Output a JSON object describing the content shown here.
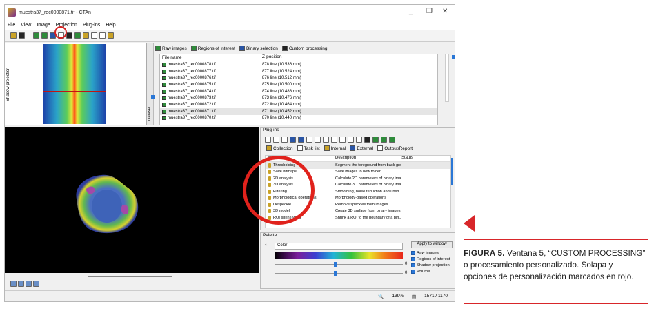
{
  "window": {
    "title": "muestra37_rec0000871.tif - CTAn",
    "controls": [
      "_",
      "❐",
      "✕"
    ]
  },
  "menu": [
    "File",
    "View",
    "Image",
    "Projection",
    "Plug-ins",
    "Help"
  ],
  "shadow_panel": {
    "label": "Shadow projection"
  },
  "dataset_panel": {
    "side_label": "Dataset",
    "tabs": [
      "Raw images",
      "Regions of interest",
      "Binary selection",
      "Custom processing"
    ],
    "columns": [
      "File name",
      "Z-position"
    ],
    "rows": [
      {
        "file": "muestra37_rec0000878.tif",
        "z": "878 line (10.536 mm)"
      },
      {
        "file": "muestra37_rec0000877.tif",
        "z": "877 line (10.524 mm)"
      },
      {
        "file": "muestra37_rec0000876.tif",
        "z": "876 line (10.512 mm)"
      },
      {
        "file": "muestra37_rec0000875.tif",
        "z": "875 line (10.500 mm)"
      },
      {
        "file": "muestra37_rec0000874.tif",
        "z": "874 line (10.488 mm)"
      },
      {
        "file": "muestra37_rec0000873.tif",
        "z": "873 line (10.476 mm)"
      },
      {
        "file": "muestra37_rec0000872.tif",
        "z": "872 line (10.464 mm)"
      },
      {
        "file": "muestra37_rec0000871.tif",
        "z": "871 line (10.452 mm)"
      },
      {
        "file": "muestra37_rec0000870.tif",
        "z": "870 line (10.440 mm)"
      }
    ]
  },
  "plugins": {
    "title": "Plug-ins",
    "tabs": [
      "Collection",
      "Task list",
      "Internal",
      "External",
      "Output/Report"
    ],
    "columns": [
      "Name",
      "Description",
      "Status"
    ],
    "rows": [
      {
        "name": "Thresholding",
        "desc": "Segment the foreground from back gro..."
      },
      {
        "name": "Save bitmaps",
        "desc": "Save images to new folder"
      },
      {
        "name": "2D analysis",
        "desc": "Calculate 2D parameters of binary ima..."
      },
      {
        "name": "3D analysis",
        "desc": "Calculate 3D parameters of binary ima..."
      },
      {
        "name": "Filtering",
        "desc": "Smoothing, noise reduction and unsh..."
      },
      {
        "name": "Morphological operations",
        "desc": "Morphology-based operations"
      },
      {
        "name": "Despeckle",
        "desc": "Remove speckles from images"
      },
      {
        "name": "3D model",
        "desc": "Create 3D surface from binary images"
      },
      {
        "name": "ROI shrink-wrap",
        "desc": "Shrink a ROI to the boundary of a bin..."
      }
    ]
  },
  "palette": {
    "title": "Palette",
    "selected": "Color",
    "zero_a": "0",
    "zero_b": "0",
    "apply_label": "Apply to window",
    "checks": [
      "Raw images",
      "Regions of interest",
      "Shadow projection",
      "Volume"
    ]
  },
  "status": {
    "zoom": "139%",
    "slice": "1571 / 1170"
  },
  "caption": {
    "label": "FIGURA 5.",
    "text": " Ventana 5, “CUSTOM PROCESSING” o procesamiento personalizado. Solapa y opciones de personalización marcados en rojo."
  },
  "colors": {
    "highlight": "#d8262a",
    "accent": "#2a77d6"
  }
}
